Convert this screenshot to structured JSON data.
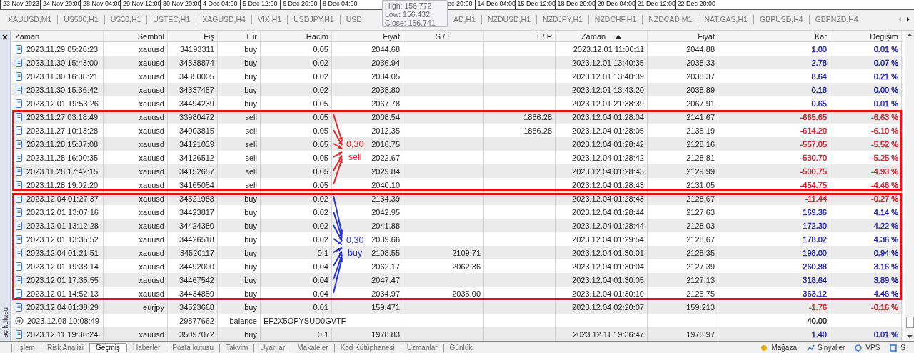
{
  "time_axis": {
    "labels_left": [
      "23 Nov 2023",
      "24 Nov 20:00",
      "28 Nov 04:00",
      "29 Nov 12:00",
      "30 Nov 20:00",
      "4 Dec 04:00",
      "5 Dec 12:00",
      "6 Dec 20:00",
      "8 Dec 04:00"
    ],
    "labels_right": [
      "ec 20:00",
      "14 Dec 04:00",
      "15 Dec 12:00",
      "18 Dec 20:00",
      "20 Dec 04:00",
      "21 Dec 12:00",
      "22 Dec 20:00"
    ]
  },
  "price_tooltip": {
    "lines": [
      "High: 156.772",
      "Low: 156.432",
      "Close: 156.741"
    ]
  },
  "chart_tabs": {
    "left": [
      "XAUUSD,M1",
      "US500,H1",
      "US30,H1",
      "USTEC,H1",
      "XAGUSD,H4",
      "VIX,H1",
      "USDJPY,H1",
      "USD"
    ],
    "right": [
      "AD,H1",
      "NZDUSD,H1",
      "NZDJPY,H1",
      "NZDCHF,H1",
      "NZDCAD,M1",
      "NAT.GAS,H1",
      "GBPUSD,H4",
      "GBPNZD,H4"
    ]
  },
  "toolbox": {
    "title": "aç kutusu"
  },
  "history": {
    "columns": [
      {
        "label": "Zaman",
        "sorted": false
      },
      {
        "label": "Sembol",
        "sorted": false
      },
      {
        "label": "Fiş",
        "sorted": false
      },
      {
        "label": "Tür",
        "sorted": false
      },
      {
        "label": "Hacim",
        "sorted": false
      },
      {
        "label": "Fiyat",
        "sorted": false
      },
      {
        "label": "S / L",
        "sorted": false
      },
      {
        "label": "T / P",
        "sorted": false
      },
      {
        "label": "Zaman",
        "sorted": true
      },
      {
        "label": "Fiyat",
        "sorted": false
      },
      {
        "label": "Kar",
        "sorted": false
      },
      {
        "label": "Değişim",
        "sorted": false
      }
    ],
    "rows": [
      {
        "kind": "deal",
        "color": "#1b1ba0",
        "time": "2023.11.29 05:26:23",
        "symbol": "xauusd",
        "ticket": "34193311",
        "type": "buy",
        "volume": "0.05",
        "price": "2044.68",
        "close_time": "2023.12.01 11:00:11",
        "close_price": "2044.88",
        "profit": "1.00",
        "change": "0.01 %"
      },
      {
        "kind": "deal",
        "color": "#1b1ba0",
        "time": "2023.11.30 15:43:00",
        "symbol": "xauusd",
        "ticket": "34338874",
        "type": "buy",
        "volume": "0.02",
        "price": "2036.94",
        "close_time": "2023.12.01 13:40:35",
        "close_price": "2038.33",
        "profit": "2.78",
        "change": "0.07 %"
      },
      {
        "kind": "deal",
        "color": "#1b1ba0",
        "time": "2023.11.30 16:38:21",
        "symbol": "xauusd",
        "ticket": "34350005",
        "type": "buy",
        "volume": "0.02",
        "price": "2034.05",
        "close_time": "2023.12.01 13:40:39",
        "close_price": "2038.37",
        "profit": "8.64",
        "change": "0.21 %"
      },
      {
        "kind": "deal",
        "color": "#1b1ba0",
        "time": "2023.11.30 15:36:42",
        "symbol": "xauusd",
        "ticket": "34337457",
        "type": "buy",
        "volume": "0.02",
        "price": "2038.80",
        "close_time": "2023.12.01 13:43:20",
        "close_price": "2038.89",
        "profit": "0.18",
        "change": "0.00 %"
      },
      {
        "kind": "deal",
        "color": "#1b1ba0",
        "time": "2023.12.01 19:53:26",
        "symbol": "xauusd",
        "ticket": "34494239",
        "type": "buy",
        "volume": "0.05",
        "price": "2067.78",
        "close_time": "2023.12.01 21:38:39",
        "close_price": "2067.91",
        "profit": "0.65",
        "change": "0.01 %"
      },
      {
        "kind": "deal",
        "color": "#c3202a",
        "time": "2023.11.27 03:18:49",
        "symbol": "xauusd",
        "ticket": "33980472",
        "type": "sell",
        "volume": "0.05",
        "price": "2008.54",
        "tp": "1886.28",
        "close_time": "2023.12.04 01:28:04",
        "close_price": "2141.67",
        "profit": "-665.65",
        "change": "-6.63 %"
      },
      {
        "kind": "deal",
        "color": "#c3202a",
        "time": "2023.11.27 10:13:28",
        "symbol": "xauusd",
        "ticket": "34003815",
        "type": "sell",
        "volume": "0.05",
        "price": "2012.35",
        "tp": "1886.28",
        "close_time": "2023.12.04 01:28:05",
        "close_price": "2135.19",
        "profit": "-614.20",
        "change": "-6.10 %"
      },
      {
        "kind": "deal",
        "color": "#c3202a",
        "time": "2023.11.28 15:37:08",
        "symbol": "xauusd",
        "ticket": "34121039",
        "type": "sell",
        "volume": "0.05",
        "price": "2016.75",
        "close_time": "2023.12.04 01:28:42",
        "close_price": "2128.16",
        "profit": "-557.05",
        "change": "-5.52 %"
      },
      {
        "kind": "deal",
        "color": "#c3202a",
        "time": "2023.11.28 16:00:35",
        "symbol": "xauusd",
        "ticket": "34126512",
        "type": "sell",
        "volume": "0.05",
        "price": "2022.67",
        "close_time": "2023.12.04 01:28:42",
        "close_price": "2128.81",
        "profit": "-530.70",
        "change": "-5.25 %"
      },
      {
        "kind": "deal",
        "color": "#c3202a",
        "time": "2023.11.28 17:42:15",
        "symbol": "xauusd",
        "ticket": "34152657",
        "type": "sell",
        "volume": "0.05",
        "price": "2029.84",
        "close_time": "2023.12.04 01:28:43",
        "close_price": "2129.99",
        "profit": "-500.75",
        "change": "-4.93 %"
      },
      {
        "kind": "deal",
        "color": "#c3202a",
        "time": "2023.11.28 19:02:20",
        "symbol": "xauusd",
        "ticket": "34165054",
        "type": "sell",
        "volume": "0.05",
        "price": "2040.10",
        "close_time": "2023.12.04 01:28:43",
        "close_price": "2131.05",
        "profit": "-454.75",
        "change": "-4.46 %"
      },
      {
        "kind": "deal",
        "color": "#c3202a",
        "time": "2023.12.04 01:27:37",
        "symbol": "xauusd",
        "ticket": "34521988",
        "type": "buy",
        "volume": "0.02",
        "price": "2134.39",
        "close_time": "2023.12.04 01:28:43",
        "close_price": "2128.67",
        "profit": "-11.44",
        "change": "-0.27 %"
      },
      {
        "kind": "deal",
        "color": "#1b1ba0",
        "time": "2023.12.01 13:07:16",
        "symbol": "xauusd",
        "ticket": "34423817",
        "type": "buy",
        "volume": "0.02",
        "price": "2042.95",
        "close_time": "2023.12.04 01:28:44",
        "close_price": "2127.63",
        "profit": "169.36",
        "change": "4.14 %"
      },
      {
        "kind": "deal",
        "color": "#1b1ba0",
        "time": "2023.12.01 13:12:28",
        "symbol": "xauusd",
        "ticket": "34424380",
        "type": "buy",
        "volume": "0.02",
        "price": "2041.88",
        "close_time": "2023.12.04 01:28:44",
        "close_price": "2128.03",
        "profit": "172.30",
        "change": "4.22 %"
      },
      {
        "kind": "deal",
        "color": "#1b1ba0",
        "time": "2023.12.01 13:35:52",
        "symbol": "xauusd",
        "ticket": "34426518",
        "type": "buy",
        "volume": "0.02",
        "price": "2039.66",
        "close_time": "2023.12.04 01:29:54",
        "close_price": "2128.67",
        "profit": "178.02",
        "change": "4.36 %"
      },
      {
        "kind": "deal",
        "color": "#1b1ba0",
        "time": "2023.12.04 01:21:51",
        "symbol": "xauusd",
        "ticket": "34520117",
        "type": "buy",
        "volume": "0.1",
        "price": "2108.55",
        "sl": "2109.71",
        "close_time": "2023.12.04 01:30:01",
        "close_price": "2128.35",
        "profit": "198.00",
        "change": "0.94 %"
      },
      {
        "kind": "deal",
        "color": "#1b1ba0",
        "time": "2023.12.01 19:38:14",
        "symbol": "xauusd",
        "ticket": "34492000",
        "type": "buy",
        "volume": "0.04",
        "price": "2062.17",
        "sl": "2062.36",
        "close_time": "2023.12.04 01:30:04",
        "close_price": "2127.39",
        "profit": "260.88",
        "change": "3.16 %"
      },
      {
        "kind": "deal",
        "color": "#1b1ba0",
        "time": "2023.12.01 17:35:55",
        "symbol": "xauusd",
        "ticket": "34467542",
        "type": "buy",
        "volume": "0.04",
        "price": "2047.47",
        "close_time": "2023.12.04 01:30:05",
        "close_price": "2127.13",
        "profit": "318.64",
        "change": "3.89 %"
      },
      {
        "kind": "deal",
        "color": "#1b1ba0",
        "time": "2023.12.01 14:52:13",
        "symbol": "xauusd",
        "ticket": "34434859",
        "type": "buy",
        "volume": "0.04",
        "price": "2034.97",
        "sl": "2035.00",
        "close_time": "2023.12.04 01:30:10",
        "close_price": "2125.75",
        "profit": "363.12",
        "change": "4.46 %"
      },
      {
        "kind": "deal",
        "color": "#c3202a",
        "time": "2023.12.04 01:38:29",
        "symbol": "eurjpy",
        "ticket": "34523668",
        "type": "buy",
        "volume": "0.01",
        "price": "159.471",
        "close_time": "2023.12.04 02:20:07",
        "close_price": "159.213",
        "profit": "-1.76",
        "change": "-0.16 %"
      },
      {
        "kind": "balance",
        "color": "#222222",
        "time": "2023.12.08 10:08:49",
        "ticket": "29877662",
        "type": "balance",
        "comment": "EF2X5OPYSUD0GVTF",
        "profit": "40.00"
      },
      {
        "kind": "deal",
        "color": "#1b1ba0",
        "time": "2023.12.11 19:36:24",
        "symbol": "xauusd",
        "ticket": "35097072",
        "type": "buy",
        "volume": "0.1",
        "price": "1978.83",
        "close_time": "2023.12.11 19:36:47",
        "close_price": "1978.97",
        "profit": "1.40",
        "change": "0.01 %"
      }
    ],
    "annotations": [
      {
        "lines": [
          "0,30",
          "sell"
        ],
        "color": "#e8262a"
      },
      {
        "lines": [
          "0,30",
          "buy"
        ],
        "color": "#2b35d6"
      }
    ]
  },
  "bottom_tabs": [
    {
      "label": "İşlem",
      "selected": false
    },
    {
      "label": "Risk Analizi",
      "selected": false
    },
    {
      "label": "Geçmiş",
      "selected": true
    },
    {
      "label": "Haberler",
      "selected": false
    },
    {
      "label": "Posta kutusu",
      "selected": false
    },
    {
      "label": "Takvim",
      "selected": false
    },
    {
      "label": "Uyarılar",
      "selected": false
    },
    {
      "label": "Makaleler",
      "selected": false
    },
    {
      "label": "Kod Kütüphanesi",
      "selected": false
    },
    {
      "label": "Uzmanlar",
      "selected": false
    },
    {
      "label": "Günlük",
      "selected": false
    }
  ],
  "bottom_links": [
    "Mağaza",
    "Sinyaller",
    "VPS",
    "S"
  ]
}
